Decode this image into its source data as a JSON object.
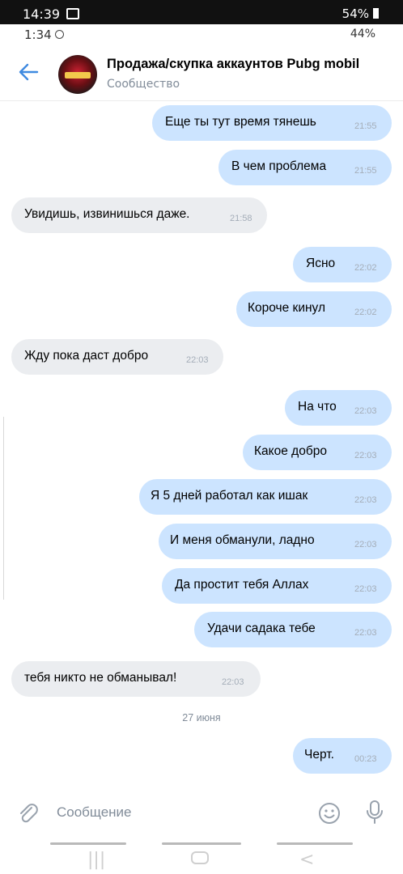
{
  "outer_status": {
    "time": "14:39",
    "right": "54%"
  },
  "inner_status": {
    "time": "1:34",
    "right": "44%"
  },
  "header": {
    "title": "Продажа/скупка аккаунтов Pubg mobil",
    "subtitle": "Сообщество"
  },
  "messages": [
    {
      "dir": "out",
      "text": "Еще ты тут время тянешь",
      "time": "21:55"
    },
    {
      "dir": "out",
      "text": "В чем проблема",
      "time": "21:55"
    },
    {
      "dir": "in",
      "text": "Увидишь, извинишься даже.",
      "time": "21:58"
    },
    {
      "dir": "out",
      "text": "Ясно",
      "time": "22:02"
    },
    {
      "dir": "out",
      "text": "Короче кинул",
      "time": "22:02"
    },
    {
      "dir": "in",
      "text": "Жду пока даст добро",
      "time": "22:03"
    },
    {
      "dir": "out",
      "text": "На что",
      "time": "22:03"
    },
    {
      "dir": "out",
      "text": "Какое добро",
      "time": "22:03"
    },
    {
      "dir": "out",
      "text": "Я 5 дней работал как ишак",
      "time": "22:03"
    },
    {
      "dir": "out",
      "text": "И меня обманули, ладно",
      "time": "22:03"
    },
    {
      "dir": "out",
      "text": "Да простит тебя Аллах",
      "time": "22:03"
    },
    {
      "dir": "out",
      "text": "Удачи садака тебе",
      "time": "22:03"
    },
    {
      "dir": "in",
      "text": "тебя никто не обманывал!",
      "time": "22:03"
    }
  ],
  "date_separator": "27 июня",
  "last_message": {
    "dir": "out",
    "text": "Черт.",
    "time": "00:23"
  },
  "composer": {
    "placeholder": "Сообщение"
  },
  "colors": {
    "outgoing_bubble": "#cce4ff",
    "incoming_bubble": "#ebedf0",
    "accent": "#3f8ae0"
  },
  "icons": [
    "back-arrow-icon",
    "paperclip-icon",
    "smile-icon",
    "microphone-icon"
  ]
}
